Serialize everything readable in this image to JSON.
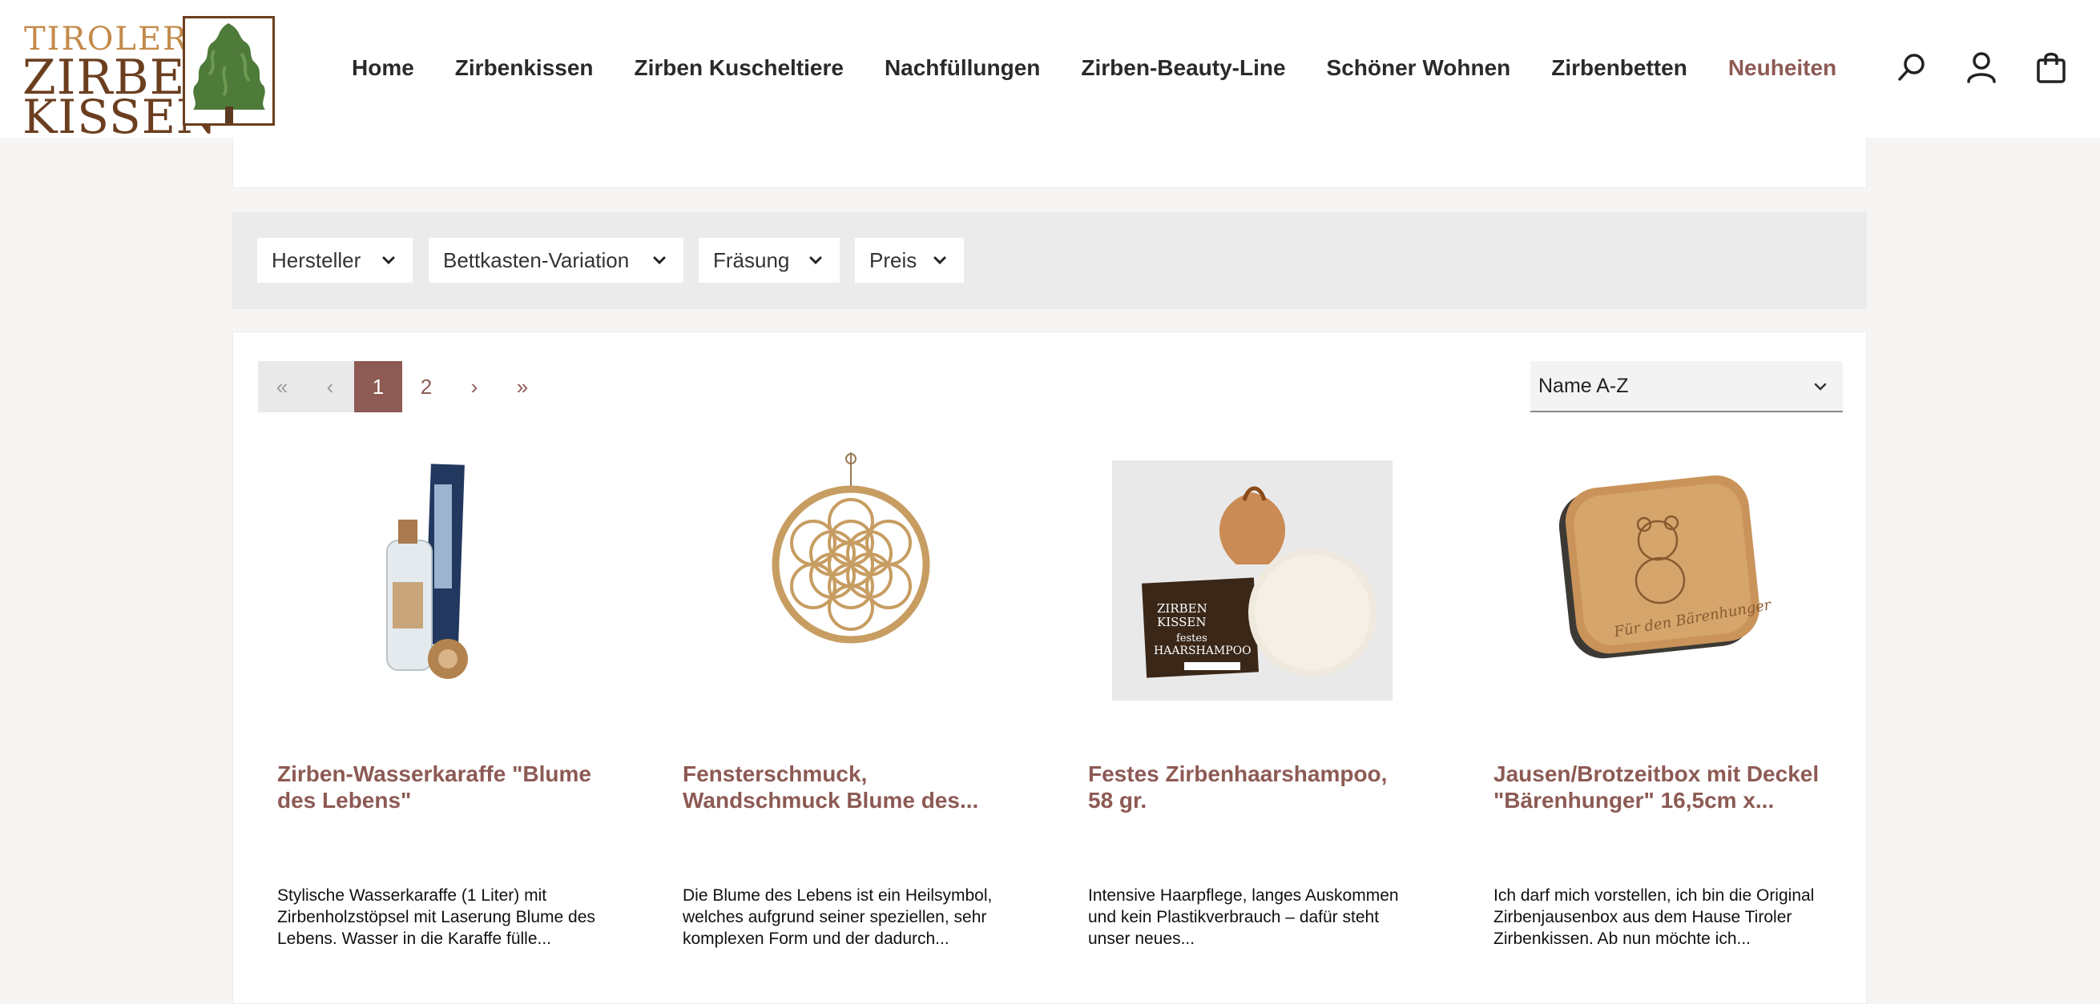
{
  "logo": {
    "line1": "TIROLER",
    "line2": "ZIRBEN",
    "line3": "KISSEN"
  },
  "nav": {
    "items": [
      {
        "label": "Home"
      },
      {
        "label": "Zirbenkissen"
      },
      {
        "label": "Zirben Kuscheltiere"
      },
      {
        "label": "Nachfüllungen"
      },
      {
        "label": "Zirben-Beauty-Line"
      },
      {
        "label": "Schöner Wohnen"
      },
      {
        "label": "Zirbenbetten"
      },
      {
        "label": "Neuheiten"
      }
    ],
    "active_index": 7
  },
  "header_icons": [
    "search-icon",
    "account-icon",
    "cart-icon"
  ],
  "filters": {
    "items": [
      {
        "label": "Hersteller"
      },
      {
        "label": "Bettkasten-Variation"
      },
      {
        "label": "Fräsung"
      },
      {
        "label": "Preis"
      }
    ]
  },
  "pagination": {
    "first": "«",
    "prev": "‹",
    "pages": [
      "1",
      "2"
    ],
    "current": "1",
    "next": "›",
    "last": "»"
  },
  "sort": {
    "selected": "Name A-Z"
  },
  "products": [
    {
      "title": "Zirben-Wasserkaraffe \"Blume des Lebens\"",
      "description": "Stylische Wasserkaraffe (1 Liter) mit Zirbenholzstöpsel mit Laserung Blume des Lebens. Wasser in die Karaffe fülle..."
    },
    {
      "title": "Fensterschmuck, Wandschmuck Blume des...",
      "description": "Die Blume des Lebens ist ein Heilsymbol, welches aufgrund seiner speziellen, sehr komplexen Form und der dadurch..."
    },
    {
      "title": "Festes Zirbenhaarshampoo, 58 gr.",
      "description": "Intensive Haarpflege, langes Auskommen und kein Plastikverbrauch – dafür steht unser neues...",
      "image_labels": [
        "ZIRBEN",
        "KISSEN",
        "festes",
        "HAARSHAMPOO"
      ]
    },
    {
      "title": "Jausen/Brotzeitbox mit Deckel \"Bärenhunger\" 16,5cm x...",
      "description": "Ich darf mich vorstellen, ich bin die Original Zirbenjausenbox aus dem Hause Tiroler Zirbenkissen. Ab nun möchte ich...",
      "image_labels": [
        "Für den Bärenhunger"
      ]
    }
  ],
  "colors": {
    "accent": "#8d5a54",
    "logo_brown": "#6b3e1f",
    "logo_gold": "#c38a4a",
    "tree_green": "#4e7a3a"
  }
}
